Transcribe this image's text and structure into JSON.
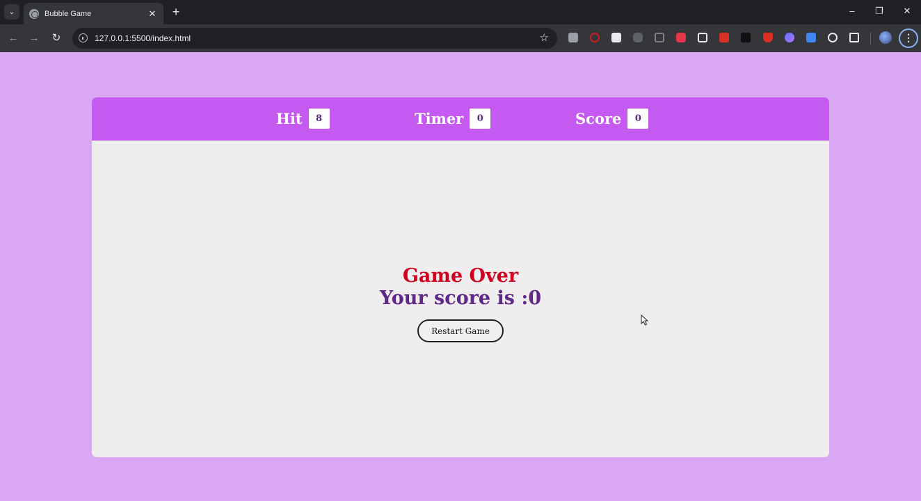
{
  "browser": {
    "tab_title": "Bubble Game",
    "tab_close": "✕",
    "new_tab": "+",
    "url": "127.0.0.1:5500/index.html",
    "window_controls": {
      "minimize": "–",
      "restore": "❐",
      "close": "✕"
    }
  },
  "game": {
    "stats": [
      {
        "label": "Hit",
        "value": "8"
      },
      {
        "label": "Timer",
        "value": "0"
      },
      {
        "label": "Score",
        "value": "0"
      }
    ],
    "game_over_text": "Game Over",
    "score_text": "Your score is :0",
    "restart_label": "Restart Game"
  },
  "colors": {
    "page_background": "#d9a7f3",
    "header_bar": "#c55af0",
    "panel_background": "#efedee",
    "game_over_red": "#d1001f",
    "score_purple": "#5f2889"
  },
  "icons": [
    "tab-list-icon",
    "globe-favicon-icon",
    "back-arrow-icon",
    "forward-arrow-icon",
    "reload-icon",
    "site-info-icon",
    "bookmark-star-icon",
    "extensions-puzzle-icon",
    "profile-avatar-icon",
    "more-menu-icon"
  ]
}
